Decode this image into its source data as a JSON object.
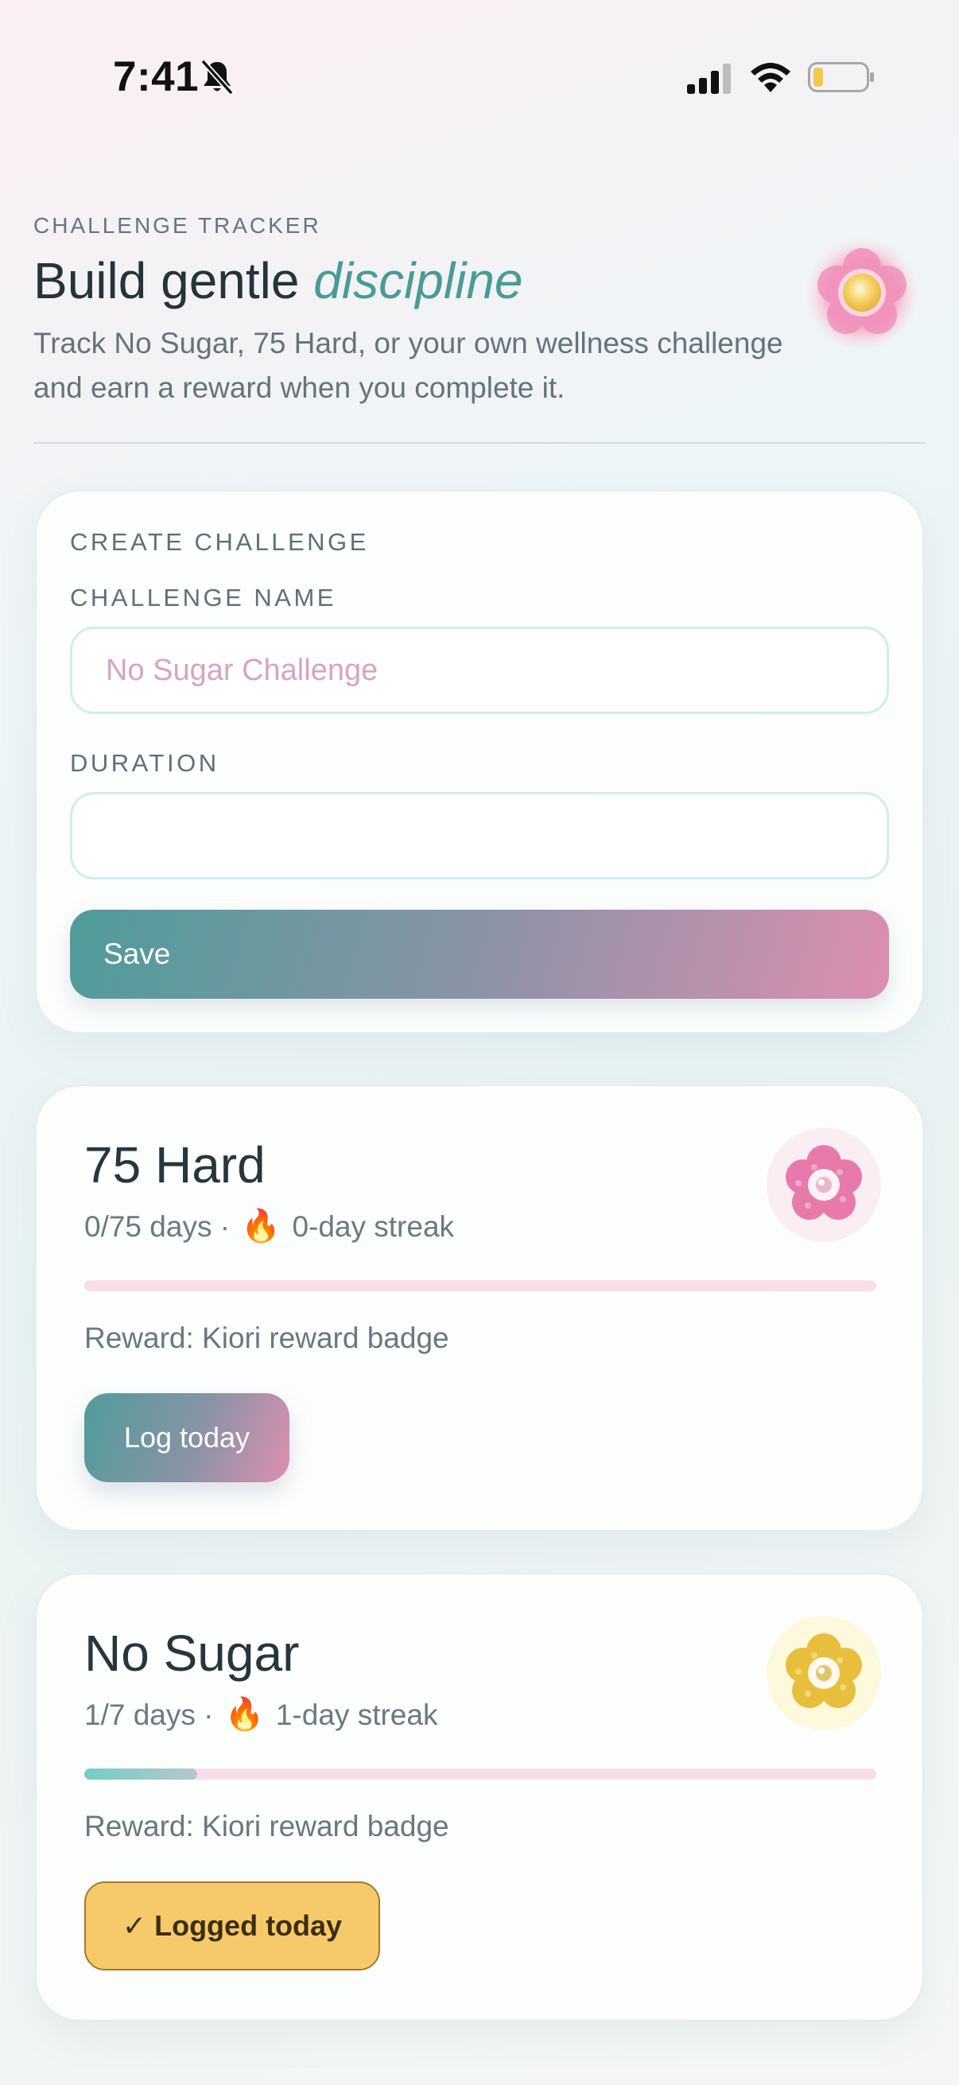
{
  "status_bar": {
    "time": "7:41",
    "icons": [
      "bell-off-icon",
      "signal-icon",
      "wifi-icon",
      "battery-icon"
    ]
  },
  "header": {
    "eyebrow": "CHALLENGE TRACKER",
    "title_lead": "Build gentle",
    "title_accent": "discipline",
    "subtitle": "Track No Sugar, 75 Hard, or your own wellness challenge and earn a reward when you complete it.",
    "badge_icon": "flower-icon"
  },
  "create_form": {
    "section_label": "CREATE CHALLENGE",
    "name_label": "CHALLENGE NAME",
    "name_placeholder": "No Sugar Challenge",
    "name_value": "",
    "duration_label": "DURATION",
    "duration_value": "",
    "save_label": "Save"
  },
  "challenges": [
    {
      "title": "75 Hard",
      "progress_text": "0/75 days",
      "separator": "·",
      "fire_icon": "🔥",
      "streak_text": "0-day streak",
      "progress_fraction": 0.0,
      "reward": "Reward: Kiori reward badge",
      "action_label": "Log today",
      "avatar_icon": "pink-flower-icon",
      "avatar_color": "#e47aaa"
    },
    {
      "title": "No Sugar",
      "progress_text": "1/7 days",
      "separator": "·",
      "fire_icon": "🔥",
      "streak_text": "1-day streak",
      "progress_fraction": 0.142857,
      "reward": "Reward: Kiori reward badge",
      "action_label": "✓ Logged today",
      "avatar_icon": "yellow-flower-icon",
      "avatar_color": "#e8bf3c"
    }
  ],
  "colors": {
    "accent_teal": "#4a9a98",
    "accent_pink": "#dc8fb0",
    "logged_yellow": "#f6c96a"
  }
}
